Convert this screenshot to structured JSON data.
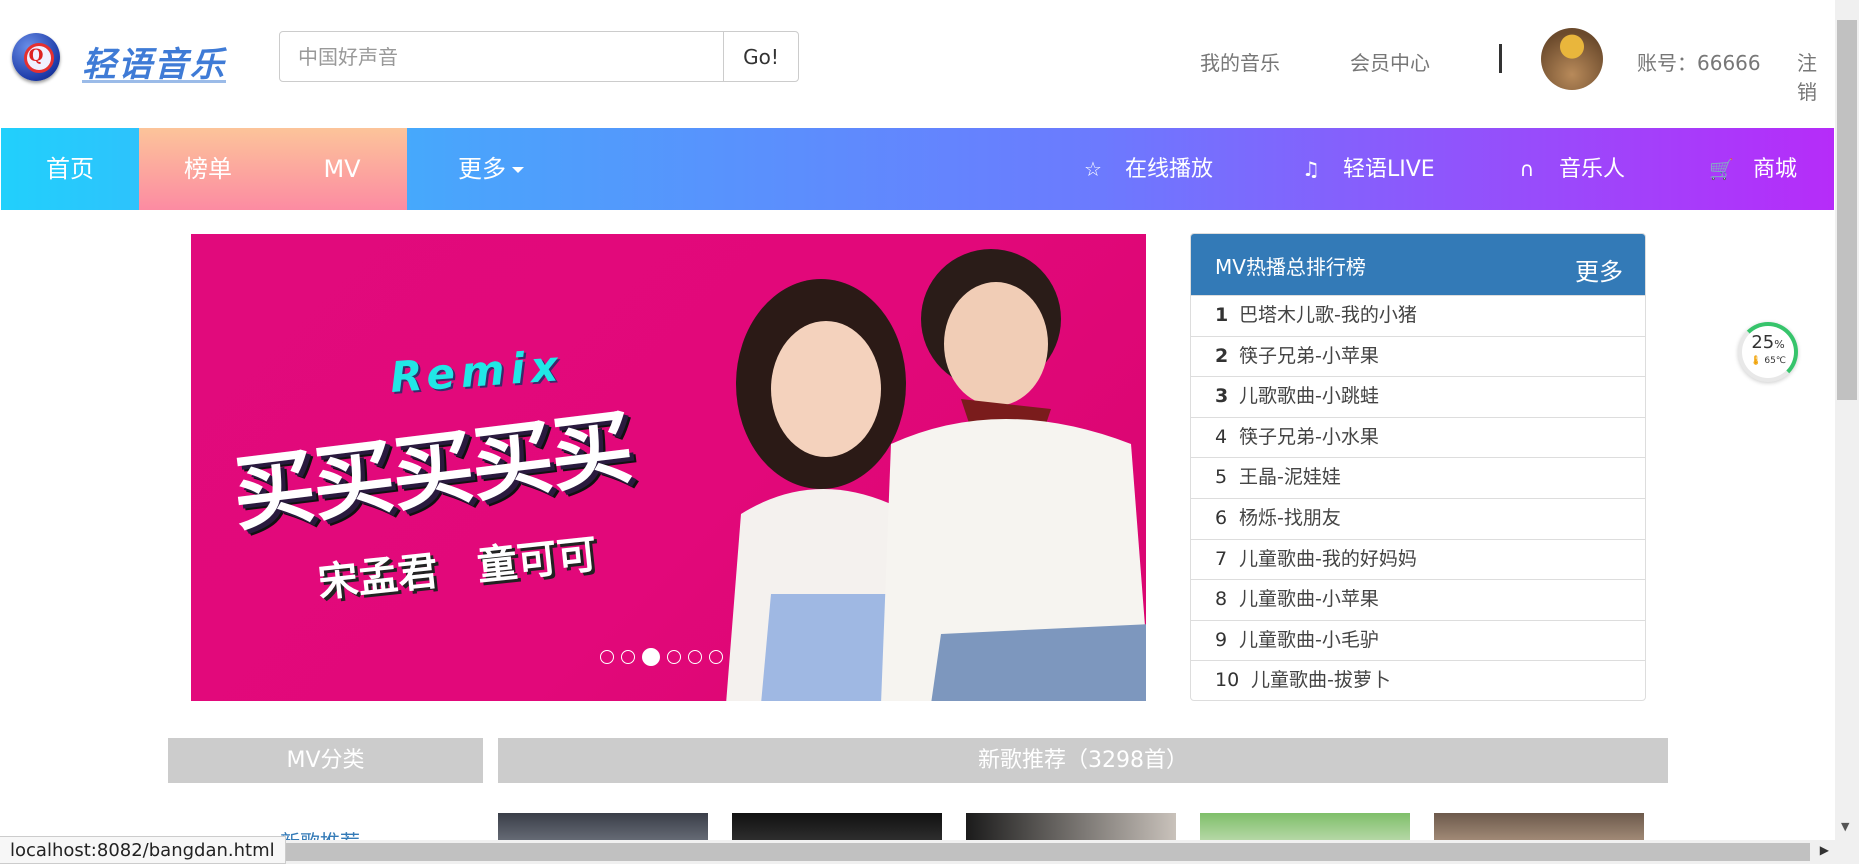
{
  "header": {
    "logo_glyph": "Q",
    "logo_text": "轻语音乐",
    "search_placeholder": "中国好声音",
    "search_button": "Go!",
    "links": [
      "我的音乐",
      "会员中心"
    ],
    "separator": "|",
    "account": "账号：66666",
    "logout": "注销"
  },
  "nav": {
    "items": [
      "首页",
      "榜单",
      "MV",
      "更多"
    ],
    "right": [
      {
        "icon": "star-icon",
        "label": "在线播放"
      },
      {
        "icon": "music-note-icon",
        "label": "轻语LIVE"
      },
      {
        "icon": "headphones-icon",
        "label": "音乐人"
      },
      {
        "icon": "cart-icon",
        "label": "商城"
      }
    ]
  },
  "banner": {
    "tag": "Remix",
    "title": "买买买买买",
    "artists": [
      "宋孟君",
      "童可可"
    ],
    "dot_count": 6,
    "active_dot": 3
  },
  "rank": {
    "title": "MV热播总排行榜",
    "more": "更多",
    "items": [
      {
        "n": "1",
        "title": "巴塔木儿歌-我的小猪"
      },
      {
        "n": "2",
        "title": "筷子兄弟-小苹果"
      },
      {
        "n": "3",
        "title": "儿歌歌曲-小跳蛙"
      },
      {
        "n": "4",
        "title": "筷子兄弟-小水果"
      },
      {
        "n": "5",
        "title": "王晶-泥娃娃"
      },
      {
        "n": "6",
        "title": "杨烁-找朋友"
      },
      {
        "n": "7",
        "title": "儿童歌曲-我的好妈妈"
      },
      {
        "n": "8",
        "title": "儿童歌曲-小苹果"
      },
      {
        "n": "9",
        "title": "儿童歌曲-小毛驴"
      },
      {
        "n": "10",
        "title": "儿童歌曲-拔萝卜"
      }
    ]
  },
  "sections": {
    "mv_category": "MV分类",
    "new_songs": "新歌推荐（3298首）",
    "mv_link": "新歌推荐"
  },
  "status_bar": {
    "url": "localhost:8082/bangdan.html"
  },
  "widget": {
    "percent": "25",
    "percent_unit": "%",
    "temp": "65℃"
  },
  "colors": {
    "nav_start": "#21d0fc",
    "nav_end": "#b62cf9",
    "active_tab": "#fc9aa0",
    "rank_header": "#337ab7",
    "banner_bg": "#e10a7c",
    "section_bar": "#cccccc"
  }
}
